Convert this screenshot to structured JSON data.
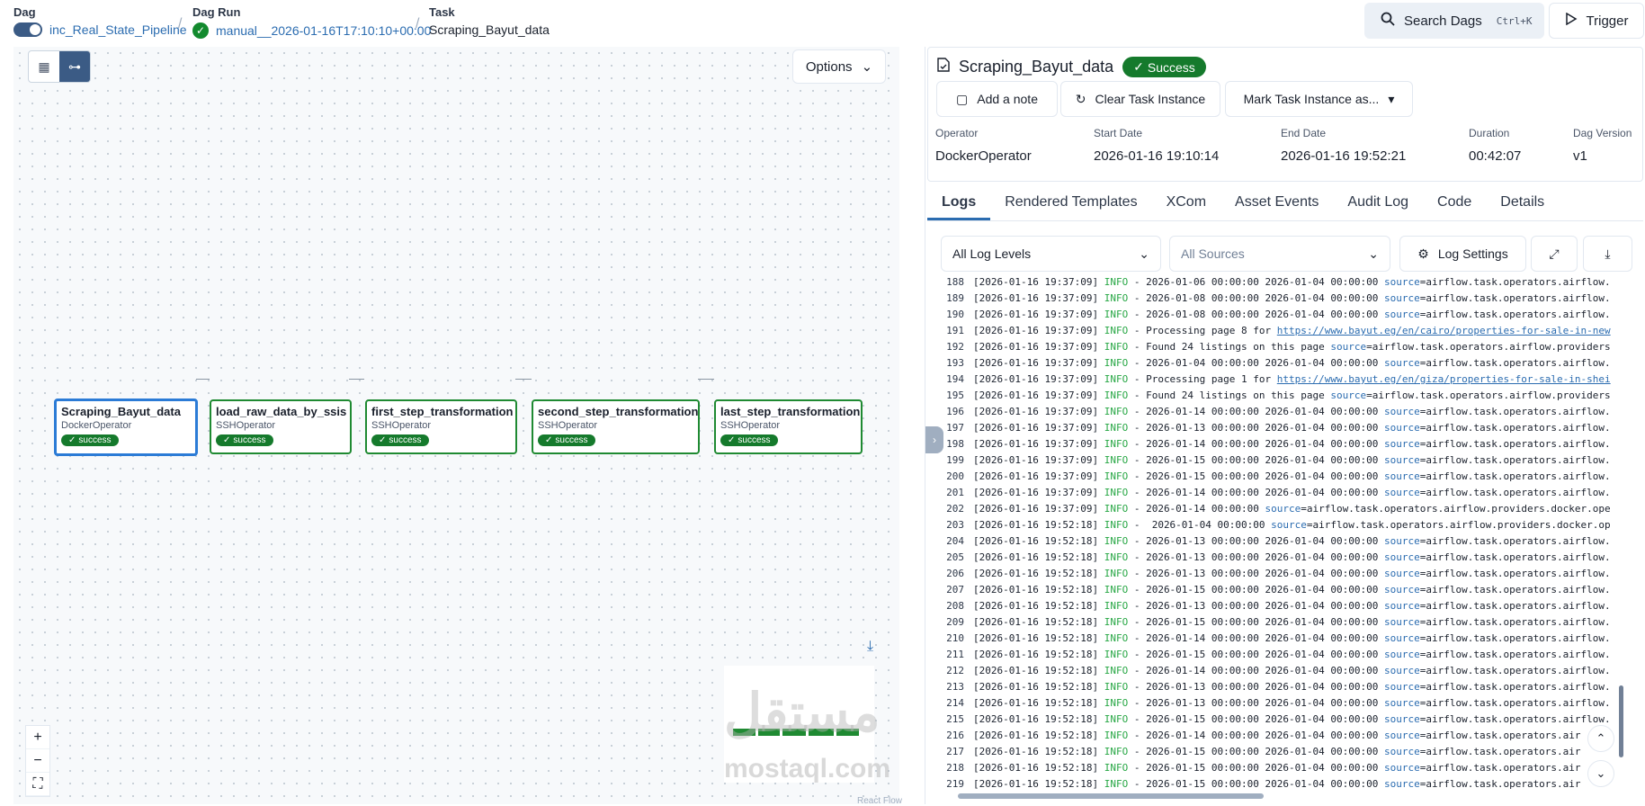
{
  "breadcrumb": {
    "dag_label": "Dag",
    "dag_value": "inc_Real_State_Pipeline",
    "run_label": "Dag Run",
    "run_value": "manual__2026-01-16T17:10:10+00:00",
    "task_label": "Task",
    "task_value": "Scraping_Bayut_data"
  },
  "header": {
    "search_label": "Search Dags",
    "search_shortcut": "Ctrl+K",
    "trigger_label": "Trigger"
  },
  "graph": {
    "options_label": "Options",
    "nodes": [
      {
        "name": "Scraping_Bayut_data",
        "operator": "DockerOperator",
        "state": "success"
      },
      {
        "name": "load_raw_data_by_ssis",
        "operator": "SSHOperator",
        "state": "success"
      },
      {
        "name": "first_step_transformation",
        "operator": "SSHOperator",
        "state": "success"
      },
      {
        "name": "second_step_transformation",
        "operator": "SSHOperator",
        "state": "success"
      },
      {
        "name": "last_step_transformation",
        "operator": "SSHOperator",
        "state": "success"
      }
    ],
    "attribution": "React Flow",
    "watermark": "مستقل",
    "watermark_site": "mostaql.com"
  },
  "task_panel": {
    "title": "Scraping_Bayut_data",
    "status": "Success",
    "actions": {
      "note": "Add a note",
      "clear": "Clear Task Instance",
      "mark": "Mark Task Instance as..."
    },
    "meta": {
      "operator_label": "Operator",
      "operator_value": "DockerOperator",
      "start_label": "Start Date",
      "start_value": "2026-01-16 19:10:14",
      "end_label": "End Date",
      "end_value": "2026-01-16 19:52:21",
      "duration_label": "Duration",
      "duration_value": "00:42:07",
      "version_label": "Dag Version",
      "version_value": "v1"
    },
    "tabs": [
      "Logs",
      "Rendered Templates",
      "XCom",
      "Asset Events",
      "Audit Log",
      "Code",
      "Details"
    ],
    "filters": {
      "levels": "All Log Levels",
      "sources": "All Sources",
      "settings": "Log Settings"
    }
  },
  "logs": [
    {
      "n": "188",
      "ts": "[2026-01-16 19:37:09]",
      "lvl": "INFO",
      "msg": " - 2026-01-06 00:00:00 2026-01-04 00:00:00 ",
      "src": "source",
      "rest": "=airflow.task.operators.airflow."
    },
    {
      "n": "189",
      "ts": "[2026-01-16 19:37:09]",
      "lvl": "INFO",
      "msg": " - 2026-01-08 00:00:00 2026-01-04 00:00:00 ",
      "src": "source",
      "rest": "=airflow.task.operators.airflow."
    },
    {
      "n": "190",
      "ts": "[2026-01-16 19:37:09]",
      "lvl": "INFO",
      "msg": " - 2026-01-08 00:00:00 2026-01-04 00:00:00 ",
      "src": "source",
      "rest": "=airflow.task.operators.airflow."
    },
    {
      "n": "191",
      "ts": "[2026-01-16 19:37:09]",
      "lvl": "INFO",
      "msg": " - Processing page 8 for ",
      "url": "https://www.bayut.eg/en/cairo/properties-for-sale-in-new"
    },
    {
      "n": "192",
      "ts": "[2026-01-16 19:37:09]",
      "lvl": "INFO",
      "msg": " - Found 24 listings on this page ",
      "src": "source",
      "rest": "=airflow.task.operators.airflow.providers"
    },
    {
      "n": "193",
      "ts": "[2026-01-16 19:37:09]",
      "lvl": "INFO",
      "msg": " - 2026-01-04 00:00:00 2026-01-04 00:00:00 ",
      "src": "source",
      "rest": "=airflow.task.operators.airflow."
    },
    {
      "n": "194",
      "ts": "[2026-01-16 19:37:09]",
      "lvl": "INFO",
      "msg": " - Processing page 1 for ",
      "url": "https://www.bayut.eg/en/giza/properties-for-sale-in-shei"
    },
    {
      "n": "195",
      "ts": "[2026-01-16 19:37:09]",
      "lvl": "INFO",
      "msg": " - Found 24 listings on this page ",
      "src": "source",
      "rest": "=airflow.task.operators.airflow.providers"
    },
    {
      "n": "196",
      "ts": "[2026-01-16 19:37:09]",
      "lvl": "INFO",
      "msg": " - 2026-01-14 00:00:00 2026-01-04 00:00:00 ",
      "src": "source",
      "rest": "=airflow.task.operators.airflow."
    },
    {
      "n": "197",
      "ts": "[2026-01-16 19:37:09]",
      "lvl": "INFO",
      "msg": " - 2026-01-13 00:00:00 2026-01-04 00:00:00 ",
      "src": "source",
      "rest": "=airflow.task.operators.airflow."
    },
    {
      "n": "198",
      "ts": "[2026-01-16 19:37:09]",
      "lvl": "INFO",
      "msg": " - 2026-01-14 00:00:00 2026-01-04 00:00:00 ",
      "src": "source",
      "rest": "=airflow.task.operators.airflow."
    },
    {
      "n": "199",
      "ts": "[2026-01-16 19:37:09]",
      "lvl": "INFO",
      "msg": " - 2026-01-15 00:00:00 2026-01-04 00:00:00 ",
      "src": "source",
      "rest": "=airflow.task.operators.airflow."
    },
    {
      "n": "200",
      "ts": "[2026-01-16 19:37:09]",
      "lvl": "INFO",
      "msg": " - 2026-01-15 00:00:00 2026-01-04 00:00:00 ",
      "src": "source",
      "rest": "=airflow.task.operators.airflow."
    },
    {
      "n": "201",
      "ts": "[2026-01-16 19:37:09]",
      "lvl": "INFO",
      "msg": " - 2026-01-14 00:00:00 2026-01-04 00:00:00 ",
      "src": "source",
      "rest": "=airflow.task.operators.airflow."
    },
    {
      "n": "202",
      "ts": "[2026-01-16 19:37:09]",
      "lvl": "INFO",
      "msg": " - 2026-01-14 00:00:00 ",
      "src": "source",
      "rest": "=airflow.task.operators.airflow.providers.docker.ope"
    },
    {
      "n": "203",
      "ts": "[2026-01-16 19:52:18]",
      "lvl": "INFO",
      "msg": " -  2026-01-04 00:00:00 ",
      "src": "source",
      "rest": "=airflow.task.operators.airflow.providers.docker.op"
    },
    {
      "n": "204",
      "ts": "[2026-01-16 19:52:18]",
      "lvl": "INFO",
      "msg": " - 2026-01-13 00:00:00 2026-01-04 00:00:00 ",
      "src": "source",
      "rest": "=airflow.task.operators.airflow."
    },
    {
      "n": "205",
      "ts": "[2026-01-16 19:52:18]",
      "lvl": "INFO",
      "msg": " - 2026-01-13 00:00:00 2026-01-04 00:00:00 ",
      "src": "source",
      "rest": "=airflow.task.operators.airflow."
    },
    {
      "n": "206",
      "ts": "[2026-01-16 19:52:18]",
      "lvl": "INFO",
      "msg": " - 2026-01-13 00:00:00 2026-01-04 00:00:00 ",
      "src": "source",
      "rest": "=airflow.task.operators.airflow."
    },
    {
      "n": "207",
      "ts": "[2026-01-16 19:52:18]",
      "lvl": "INFO",
      "msg": " - 2026-01-15 00:00:00 2026-01-04 00:00:00 ",
      "src": "source",
      "rest": "=airflow.task.operators.airflow."
    },
    {
      "n": "208",
      "ts": "[2026-01-16 19:52:18]",
      "lvl": "INFO",
      "msg": " - 2026-01-13 00:00:00 2026-01-04 00:00:00 ",
      "src": "source",
      "rest": "=airflow.task.operators.airflow."
    },
    {
      "n": "209",
      "ts": "[2026-01-16 19:52:18]",
      "lvl": "INFO",
      "msg": " - 2026-01-15 00:00:00 2026-01-04 00:00:00 ",
      "src": "source",
      "rest": "=airflow.task.operators.airflow."
    },
    {
      "n": "210",
      "ts": "[2026-01-16 19:52:18]",
      "lvl": "INFO",
      "msg": " - 2026-01-14 00:00:00 2026-01-04 00:00:00 ",
      "src": "source",
      "rest": "=airflow.task.operators.airflow."
    },
    {
      "n": "211",
      "ts": "[2026-01-16 19:52:18]",
      "lvl": "INFO",
      "msg": " - 2026-01-15 00:00:00 2026-01-04 00:00:00 ",
      "src": "source",
      "rest": "=airflow.task.operators.airflow."
    },
    {
      "n": "212",
      "ts": "[2026-01-16 19:52:18]",
      "lvl": "INFO",
      "msg": " - 2026-01-14 00:00:00 2026-01-04 00:00:00 ",
      "src": "source",
      "rest": "=airflow.task.operators.airflow."
    },
    {
      "n": "213",
      "ts": "[2026-01-16 19:52:18]",
      "lvl": "INFO",
      "msg": " - 2026-01-13 00:00:00 2026-01-04 00:00:00 ",
      "src": "source",
      "rest": "=airflow.task.operators.airflow."
    },
    {
      "n": "214",
      "ts": "[2026-01-16 19:52:18]",
      "lvl": "INFO",
      "msg": " - 2026-01-13 00:00:00 2026-01-04 00:00:00 ",
      "src": "source",
      "rest": "=airflow.task.operators.airflow."
    },
    {
      "n": "215",
      "ts": "[2026-01-16 19:52:18]",
      "lvl": "INFO",
      "msg": " - 2026-01-15 00:00:00 2026-01-04 00:00:00 ",
      "src": "source",
      "rest": "=airflow.task.operators.airflow."
    },
    {
      "n": "216",
      "ts": "[2026-01-16 19:52:18]",
      "lvl": "INFO",
      "msg": " - 2026-01-14 00:00:00 2026-01-04 00:00:00 ",
      "src": "source",
      "rest": "=airflow.task.operators.air"
    },
    {
      "n": "217",
      "ts": "[2026-01-16 19:52:18]",
      "lvl": "INFO",
      "msg": " - 2026-01-15 00:00:00 2026-01-04 00:00:00 ",
      "src": "source",
      "rest": "=airflow.task.operators.air"
    },
    {
      "n": "218",
      "ts": "[2026-01-16 19:52:18]",
      "lvl": "INFO",
      "msg": " - 2026-01-15 00:00:00 2026-01-04 00:00:00 ",
      "src": "source",
      "rest": "=airflow.task.operators.air"
    },
    {
      "n": "219",
      "ts": "[2026-01-16 19:52:18]",
      "lvl": "INFO",
      "msg": " - 2026-01-15 00:00:00 2026-01-04 00:00:00 ",
      "src": "source",
      "rest": "=airflow.task.operators.air"
    }
  ]
}
